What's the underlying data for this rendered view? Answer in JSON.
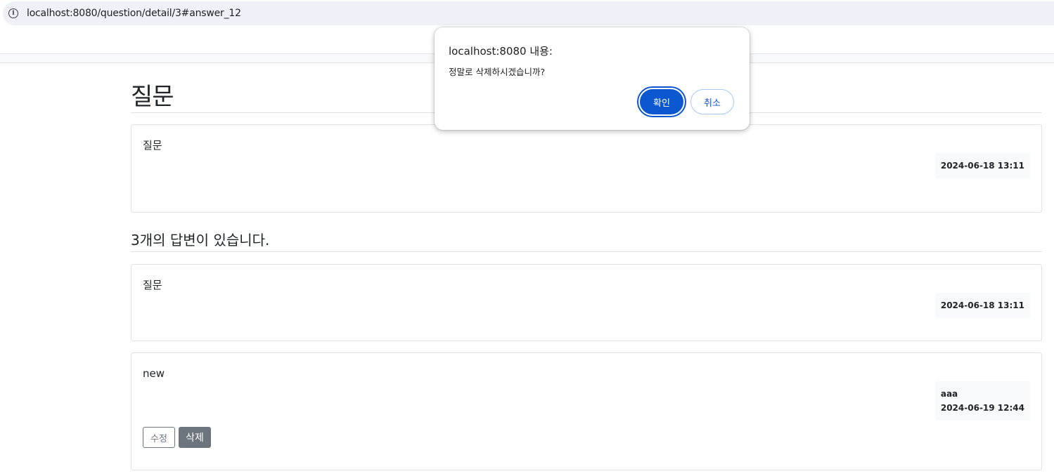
{
  "browser": {
    "url": "localhost:8080/question/detail/3#answer_12"
  },
  "page": {
    "title": "질문",
    "question": {
      "content": "질문",
      "date": "2024-06-18 13:11"
    },
    "answers_heading": "3개의 답변이 있습니다.",
    "answers": [
      {
        "content": "질문",
        "author": "",
        "date": "2024-06-18 13:11"
      },
      {
        "content": "new",
        "author": "aaa",
        "date": "2024-06-19 12:44",
        "edit_label": "수정",
        "delete_label": "삭제"
      }
    ]
  },
  "dialog": {
    "title": "localhost:8080 내용:",
    "message": "정말로 삭제하시겠습니까?",
    "ok_label": "확인",
    "cancel_label": "취소"
  },
  "colors": {
    "accent": "#0b57d0",
    "secondary": "#6c757d",
    "badge_bg": "#f8f9fa"
  }
}
